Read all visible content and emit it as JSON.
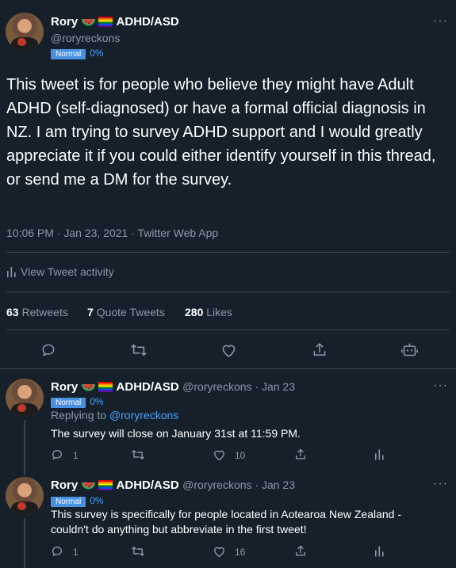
{
  "main_tweet": {
    "author_name": "Rory",
    "author_suffix": "ADHD/ASD",
    "handle": "@roryreckons",
    "badge": "Normal",
    "badge_percent": "0%",
    "text": "This tweet is for people who believe they might have Adult ADHD (self-diagnosed) or have a formal official diagnosis in NZ. I am trying to survey ADHD support and I would greatly appreciate it if you could either identify yourself in this thread, or send me a DM for the survey.",
    "timestamp": "10:06 PM · Jan 23, 2021 · Twitter Web App",
    "activity_label": "View Tweet activity",
    "retweets_count": "63",
    "retweets_label": "Retweets",
    "quote_count": "7",
    "quote_label": "Quote Tweets",
    "likes_count": "280",
    "likes_label": "Likes"
  },
  "replies": [
    {
      "author_name": "Rory",
      "author_suffix": "ADHD/ASD",
      "handle_date": "@roryreckons · Jan 23",
      "badge": "Normal",
      "badge_percent": "0%",
      "replying_prefix": "Replying to",
      "replying_handle": "@roryreckons",
      "text": "The survey will close on January 31st at 11:59 PM.",
      "reply_count": "1",
      "like_count": "10"
    },
    {
      "author_name": "Rory",
      "author_suffix": "ADHD/ASD",
      "handle_date": "@roryreckons · Jan 23",
      "badge": "Normal",
      "badge_percent": "0%",
      "text": "This survey is specifically for people located in Aotearoa New Zealand - couldn't do anything but abbreviate in the first tweet!",
      "reply_count": "1",
      "like_count": "16"
    }
  ],
  "icons": {
    "more": "more-icon",
    "reply": "reply-icon",
    "retweet": "retweet-icon",
    "like": "heart-icon",
    "share": "share-icon",
    "bot": "bot-icon",
    "analytics": "analytics-icon",
    "watermelon": "watermelon-icon",
    "rainbow_flag": "rainbow-flag-icon"
  },
  "colors": {
    "background": "#15202b",
    "accent": "#4aa3ff",
    "badge": "#4a90e2",
    "muted": "#8b98a5"
  }
}
